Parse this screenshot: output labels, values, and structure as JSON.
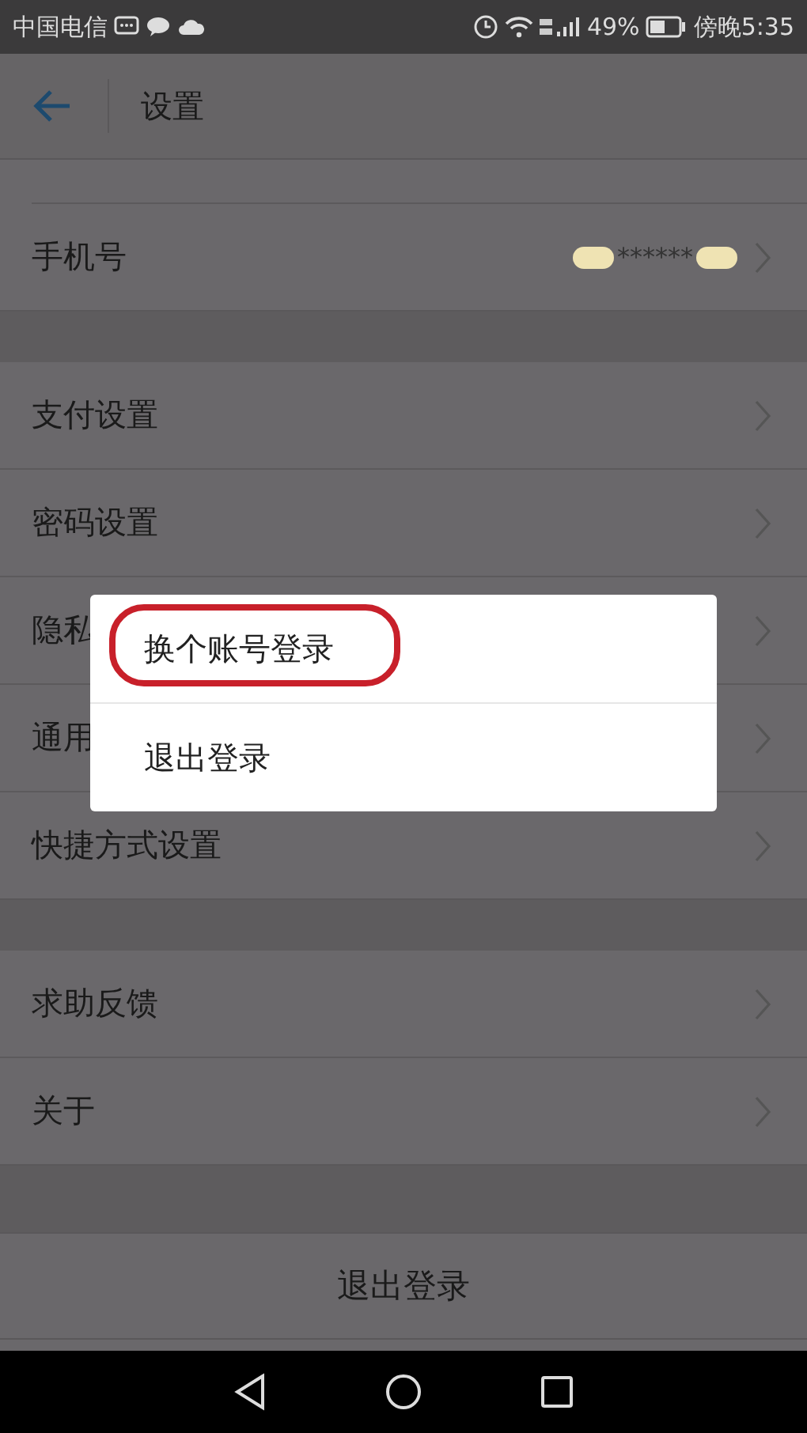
{
  "status_bar": {
    "carrier": "中国电信",
    "battery": "49%",
    "time": "傍晚5:35"
  },
  "header": {
    "title": "设置"
  },
  "sections": [
    {
      "rows": [
        {
          "label": "手机号",
          "value": "******"
        }
      ]
    },
    {
      "rows": [
        {
          "label": "支付设置"
        },
        {
          "label": "密码设置"
        },
        {
          "label": "隐私"
        },
        {
          "label": "通用"
        },
        {
          "label": "快捷方式设置"
        }
      ]
    },
    {
      "rows": [
        {
          "label": "求助反馈"
        },
        {
          "label": "关于"
        }
      ]
    }
  ],
  "logout_button": "退出登录",
  "popup_menu": [
    {
      "label": "换个账号登录",
      "highlighted": true
    },
    {
      "label": "退出登录",
      "highlighted": false
    }
  ]
}
